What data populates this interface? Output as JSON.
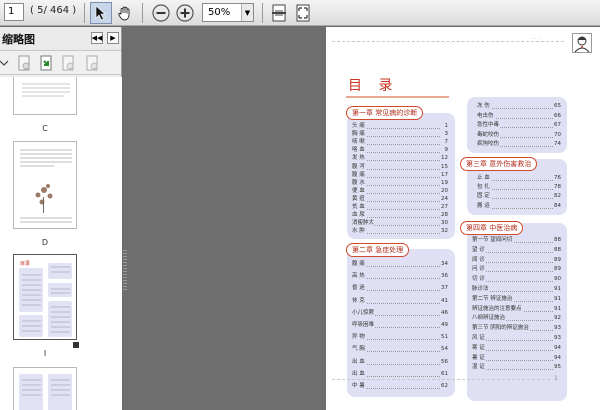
{
  "toolbar": {
    "page_current": "1",
    "page_total": "( 5/ 464 )",
    "zoom_value": "50%"
  },
  "sidebar": {
    "title": "缩略图",
    "thumbnails": [
      {
        "label": "C"
      },
      {
        "label": "D"
      },
      {
        "label": "I"
      },
      {
        "label": ""
      }
    ]
  },
  "page": {
    "toc_title": "目 录",
    "page_number": "1",
    "left_column": {
      "chapters": [
        {
          "title": "第一章  常见病的诊断",
          "entries": [
            {
              "label": "头 痛",
              "page": "1"
            },
            {
              "label": "胸 痛",
              "page": "3"
            },
            {
              "label": "咳 嗽",
              "page": "7"
            },
            {
              "label": "咯 血",
              "page": "9"
            },
            {
              "label": "发 热",
              "page": "12"
            },
            {
              "label": "腹 泻",
              "page": "15"
            },
            {
              "label": "腹 痛",
              "page": "17"
            },
            {
              "label": "腹 水",
              "page": "19"
            },
            {
              "label": "便 血",
              "page": "20"
            },
            {
              "label": "黄 疸",
              "page": "24"
            },
            {
              "label": "贫 血",
              "page": "27"
            },
            {
              "label": "血 尿",
              "page": "28"
            },
            {
              "label": "消瘦肿大",
              "page": "30"
            },
            {
              "label": "水 肿",
              "page": "32"
            }
          ]
        },
        {
          "title": "第二章  急症处理",
          "entries": [
            {
              "label": "腹 痛",
              "page": "34"
            },
            {
              "label": "高 热",
              "page": "36"
            },
            {
              "label": "昏 迷",
              "page": "37"
            },
            {
              "label": "休 克",
              "page": "41"
            },
            {
              "label": "小儿惊厥",
              "page": "46"
            },
            {
              "label": "呼吸困难",
              "page": "49"
            },
            {
              "label": "异 物",
              "page": "51"
            },
            {
              "label": "气 胸",
              "page": "54"
            },
            {
              "label": "出 血",
              "page": "56"
            },
            {
              "label": "出 血",
              "page": "61"
            },
            {
              "label": "中 暑",
              "page": "62"
            }
          ]
        }
      ]
    },
    "right_column": {
      "top_entries": [
        {
          "label": "冻 伤",
          "page": "65"
        },
        {
          "label": "电击伤",
          "page": "66"
        },
        {
          "label": "急性中毒",
          "page": "67"
        },
        {
          "label": "毒蛇咬伤",
          "page": "70"
        },
        {
          "label": "疯狗咬伤",
          "page": "74"
        }
      ],
      "chapters": [
        {
          "title": "第三章  意外伤害救治",
          "entries": [
            {
              "label": "止 血",
              "page": "76"
            },
            {
              "label": "包 扎",
              "page": "78"
            },
            {
              "label": "固 定",
              "page": "82"
            },
            {
              "label": "搬 运",
              "page": "84"
            }
          ]
        },
        {
          "title": "第四章  中医治病",
          "entries": [
            {
              "label": "第一节  望闻问切",
              "page": "88"
            },
            {
              "label": "望 诊",
              "page": "88"
            },
            {
              "label": "闻 诊",
              "page": "89"
            },
            {
              "label": "问 诊",
              "page": "89"
            },
            {
              "label": "切 诊",
              "page": "90"
            },
            {
              "label": "脉诊法",
              "page": "91"
            },
            {
              "label": "第二节  辨证施治",
              "page": "91"
            },
            {
              "label": "辨证施治的注意要点",
              "page": "91"
            },
            {
              "label": "八纲辨证施治",
              "page": "92"
            },
            {
              "label": "第三节  阴阳的辨证施治",
              "page": "93"
            },
            {
              "label": "风 证",
              "page": "93"
            },
            {
              "label": "寒 证",
              "page": "94"
            },
            {
              "label": "暑 证",
              "page": "94"
            },
            {
              "label": "湿 证",
              "page": "95"
            }
          ]
        }
      ]
    }
  }
}
